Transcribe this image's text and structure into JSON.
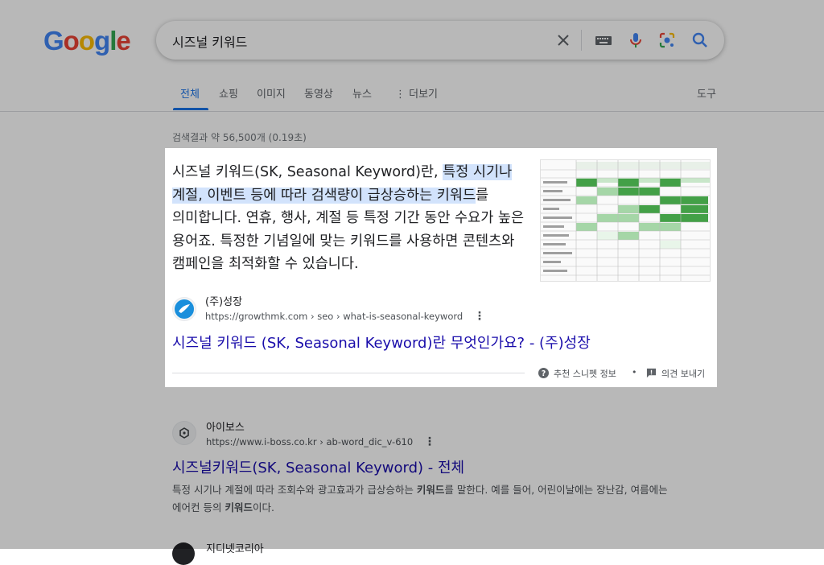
{
  "logo": {
    "letters": [
      "G",
      "o",
      "o",
      "g",
      "l",
      "e"
    ],
    "colors": [
      "#4285F4",
      "#EA4335",
      "#FBBC05",
      "#4285F4",
      "#34A853",
      "#EA4335"
    ]
  },
  "search": {
    "query": "시즈널 키워드"
  },
  "tabs": [
    {
      "label": "전체",
      "active": true
    },
    {
      "label": "쇼핑"
    },
    {
      "label": "이미지"
    },
    {
      "label": "동영상"
    },
    {
      "label": "뉴스"
    },
    {
      "label": "⋮ 더보기"
    }
  ],
  "tools_label": "도구",
  "result_count": "검색결과 약 56,500개 (0.19초)",
  "snippet": {
    "text_before": "시즈널 키워드(SK, Seasonal Keyword)란, ",
    "text_highlight": "특정 시기나 계절, 이벤트 등에 따라 검색량이 급상승하는 키워드",
    "text_after": "를 의미합니다. 연휴, 행사, 계절 등 특정 기간 동안 수요가 높은 용어죠. 특정한 기념일에 맞는 키워드를 사용하면 콘텐츠와 캠페인을 최적화할 수 있습니다.",
    "source_name": "(주)성장",
    "source_url": "https://growthmk.com › seo › what-is-seasonal-keyword",
    "link_title": "시즈널 키워드 (SK, Seasonal Keyword)란 무엇인가요? - (주)성장",
    "about_label": "추천 스니펫 정보",
    "feedback_label": "의견 보내기",
    "bullet": "•"
  },
  "result2": {
    "source_name": "아이보스",
    "source_url": "https://www.i-boss.co.kr › ab-word_dic_v-610",
    "title": "시즈널키워드(SK, Seasonal Keyword) - 전체",
    "desc_1": "특정 시기나 계절에 따라 조회수와 광고효과가 급상승하는 ",
    "desc_bold_1": "키워드",
    "desc_2": "를 말한다. 예를 들어, 어린이날에는 장난감, 여름에는 에어컨 등의 ",
    "desc_bold_2": "키워드",
    "desc_3": "이다."
  },
  "result3": {
    "source_name": "지디넷코리아"
  }
}
